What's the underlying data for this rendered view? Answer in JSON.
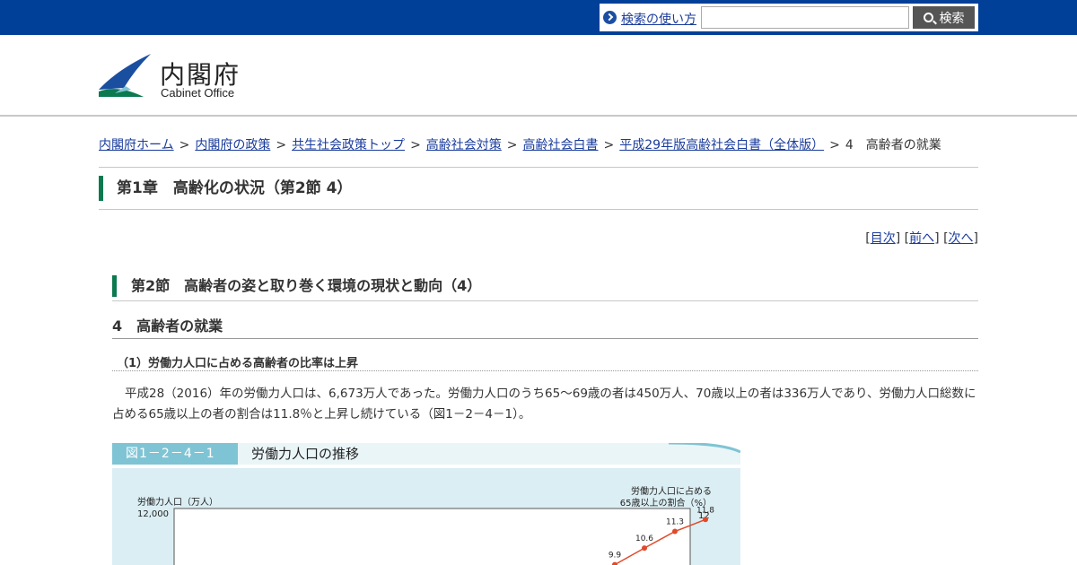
{
  "header": {
    "help_link": "検索の使い方",
    "search_placeholder": "",
    "search_button": "検索",
    "logo_ja": "内閣府",
    "logo_en": "Cabinet Office"
  },
  "breadcrumb": {
    "items": [
      "内閣府ホーム",
      "内閣府の政策",
      "共生社会政策トップ",
      "高齢社会対策",
      "高齢社会白書",
      "平成29年版高齢社会白書（全体版）"
    ],
    "current": "4　高齢者の就業",
    "separator": ">"
  },
  "chapter_title": "第1章　高齢化の状況（第2節 4）",
  "pager": {
    "toc": "目次",
    "prev": "前へ",
    "next": "次へ"
  },
  "section_title": "第2節　高齢者の姿と取り巻く環境の現状と動向（4）",
  "subsection_title": "4　高齢者の就業",
  "para_heading": "（1）労働力人口に占める高齢者の比率は上昇",
  "body_text": "平成28（2016）年の労働力人口は、6,673万人であった。労働力人口のうち65～69歳の者は450万人、70歳以上の者は336万人であり、労働力人口総数に占める65歳以上の者の割合は11.8％と上昇し続けている（図1－2－4－1）。",
  "figure": {
    "number": "図1－2－4－1",
    "title": "労働力人口の推移"
  },
  "chart_data": {
    "type": "line",
    "left_axis_label": "労働力人口（万人）",
    "left_axis_top_tick": "12,000",
    "right_axis_label_line1": "労働力人口に占める",
    "right_axis_label_line2": "65歳以上の割合（%）",
    "right_axis_top_tick": "12",
    "series": [
      {
        "values": [
          9.9,
          10.6,
          11.3,
          11.8
        ]
      }
    ],
    "line_color": "#e04a2a"
  }
}
